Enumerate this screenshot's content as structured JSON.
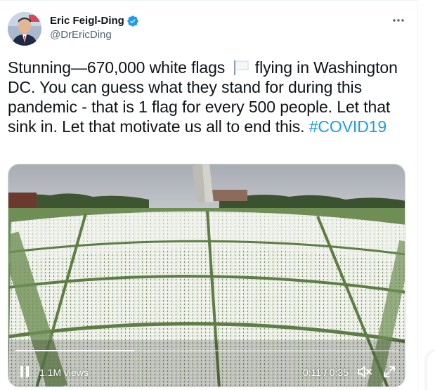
{
  "tweet": {
    "author_name": "Eric Feigl-Ding",
    "handle": "@DrEricDing",
    "text_before_flag": "Stunning—670,000 white flags",
    "text_after_flag": "flying in Washington DC. You can guess what they stand for during this pandemic - that is 1 flag for every 500 people. Let that sink in. Let that motivate us all to end this.",
    "hashtag": "#COVID19",
    "more_icon": "more-horizontal-icon",
    "verified_icon": "verified-badge-icon",
    "flag_emoji_icon": "white-flag-icon"
  },
  "video": {
    "views": "1.1M views",
    "time": "0:11 / 0:35",
    "progress": 0.31,
    "pause_icon": "pause-icon",
    "mute_icon": "muted-speaker-icon",
    "expand_icon": "expand-icon"
  },
  "colors": {
    "accent": "#1d9bf0",
    "text": "#0f1419",
    "secondary_text": "#536471"
  }
}
